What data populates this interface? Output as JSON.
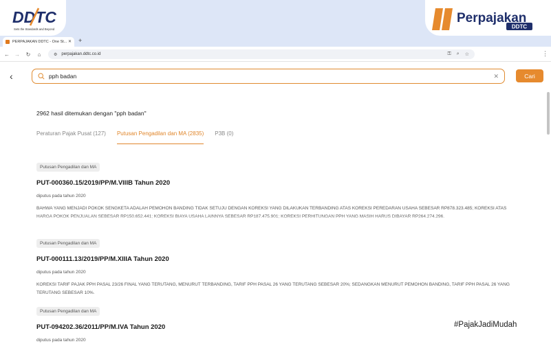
{
  "branding": {
    "ddtc_logo_text": "DDTC",
    "ddtc_tagline": "Sets the Standards and Beyond",
    "perpajakan_brand": "Perpajakan",
    "perpajakan_sub": "DDTC",
    "hashtag": "#PajakJadiMudah",
    "accent_color": "#e68a2e",
    "brand_blue": "#1f2f6b"
  },
  "browser": {
    "tab_title": "PERPAJAKAN DDTC - One St...",
    "url": "perpajakan.ddtc.co.id"
  },
  "search": {
    "query": "pph badan",
    "button_label": "Cari"
  },
  "results_summary": "2962 hasil ditemukan dengan \"pph badan\"",
  "tabs": [
    {
      "label": "Peraturan Pajak Pusat (127)",
      "active": false
    },
    {
      "label": "Putusan Pengadilan dan MA (2835)",
      "active": true
    },
    {
      "label": "P3B (0)",
      "active": false
    }
  ],
  "results": [
    {
      "badge": "Putusan Pengadilan dan MA",
      "title": "PUT-000360.15/2019/PP/M.VIIIB Tahun 2020",
      "date": "diputus pada tahun 2020",
      "snippet": "BAHWA YANG MENJADI POKOK SENGKETA ADALAH PEMOHON BANDING TIDAK SETUJU DENGAN KOREKSI YANG DILAKUKAN TERBANDING ATAS KOREKSI PEREDARAN USAHA SEBESAR RP878.323.485; KOREKSI ATAS HARGA POKOK PENJUALAN SEBESAR RP150.652.441; KOREKSI BIAYA USAHA LAINNYA SEBESAR RP187.475.901; KOREKSI PERHITUNGAN PPH YANG MASIH HARUS DIBAYAR RP264.274.296."
    },
    {
      "badge": "Putusan Pengadilan dan MA",
      "title": "PUT-000111.13/2019/PP/M.XIIIA Tahun 2020",
      "date": "diputus pada tahun 2020",
      "snippet": "KOREKSI TARIF PAJAK PPH PASAL 23/26 FINAL YANG TERUTANG, MENURUT TERBANDING, TARIF PPH PASAL 26 YANG TERUTANG SEBESAR 20%; SEDANGKAN MENURUT PEMOHON BANDING, TARIF PPH PASAL 26 YANG TERUTANG SEBESAR 10%."
    },
    {
      "badge": "Putusan Pengadilan dan MA",
      "title": "PUT-094202.36/2011/PP/M.IVA Tahun 2020",
      "date": "diputus pada tahun 2020",
      "snippet": ""
    }
  ]
}
